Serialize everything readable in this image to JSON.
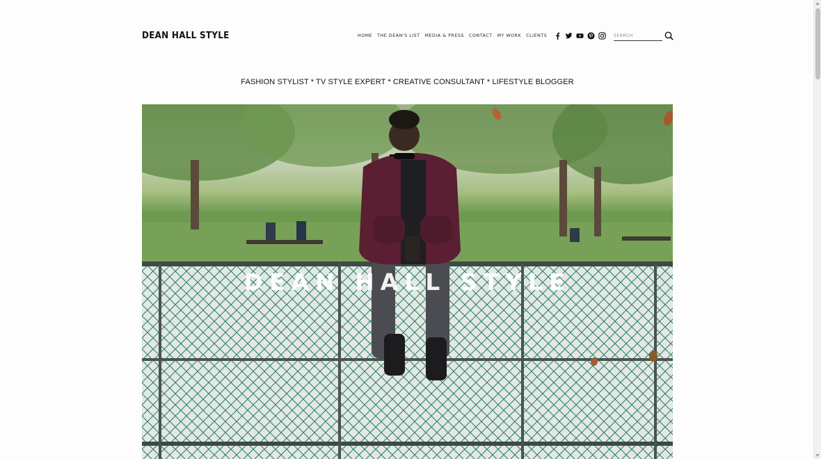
{
  "header": {
    "logo": "DEAN HALL STYLE",
    "nav": [
      "HOME",
      "THE DEAN'S LIST",
      "MEDIA & PRESS",
      "CONTACT",
      "MY WORK",
      "CLIENTS"
    ],
    "social_icons": [
      "facebook-icon",
      "twitter-icon",
      "youtube-icon",
      "pinterest-icon",
      "instagram-icon"
    ],
    "search_placeholder": "SEARCH"
  },
  "tagline": "FASHION STYLIST * TV STYLE EXPERT * CREATIVE CONSULTANT * LIFESTYLE BLOGGER",
  "hero": {
    "title": "DEAN HALL STYLE",
    "image_description": "man seated on a park fence"
  },
  "colors": {
    "text": "#111111",
    "background": "#fdfdfd",
    "fence": "#3e4a44",
    "mesh": "#1f7a68",
    "jacket": "#5a1f33"
  }
}
